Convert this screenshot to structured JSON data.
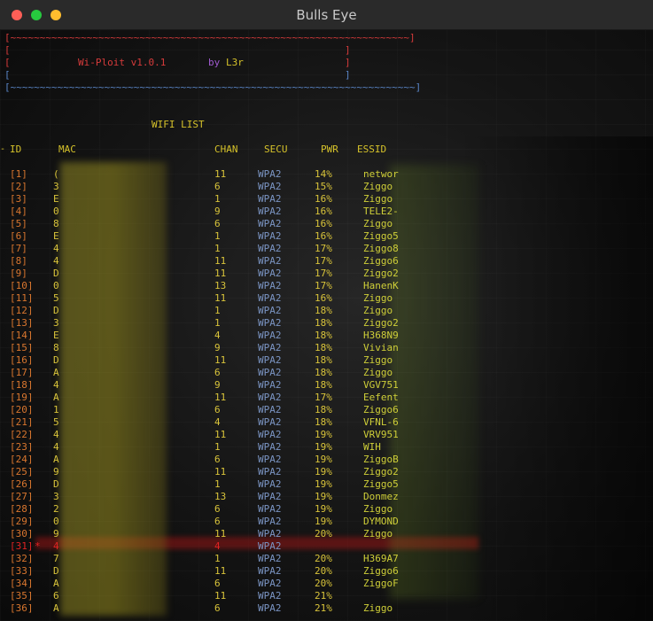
{
  "window": {
    "title": "Bulls Eye"
  },
  "banner": {
    "border_top": "[~~~~~~~~~~~~~~~~~~~~~~~~~~~~~~~~~~~~~~~~~~~~~~~~~~~~~~~~~~~~~~~~~~~~]",
    "side_left": "[",
    "side_right": "]",
    "border_bottom": "[~~~~~~~~~~~~~~~~~~~~~~~~~~~~~~~~~~~~~~~~~~~~~~~~~~~~~~~~~~~~~~~~~~~~~]",
    "app_name": "Wi-Ploit v1.0.1",
    "by_label": "by",
    "author": "L3r"
  },
  "list_title": "WIFI LIST",
  "columns": {
    "id": "ID",
    "mac": "MAC",
    "chan": "CHAN",
    "secu": "SECU",
    "pwr": "PWR",
    "essid": "ESSID"
  },
  "selected_row": 31,
  "rows": [
    {
      "idx": "[1]",
      "mac": "(",
      "chan": "11",
      "secu": "WPA2",
      "pwr": "14%",
      "essid": "networ"
    },
    {
      "idx": "[2]",
      "mac": "3",
      "chan": "6",
      "secu": "WPA2",
      "pwr": "15%",
      "essid": "Ziggo"
    },
    {
      "idx": "[3]",
      "mac": "E",
      "chan": "1",
      "secu": "WPA2",
      "pwr": "16%",
      "essid": "Ziggo"
    },
    {
      "idx": "[4]",
      "mac": "0",
      "chan": "9",
      "secu": "WPA2",
      "pwr": "16%",
      "essid": "TELE2-"
    },
    {
      "idx": "[5]",
      "mac": "8",
      "chan": "6",
      "secu": "WPA2",
      "pwr": "16%",
      "essid": "Ziggo"
    },
    {
      "idx": "[6]",
      "mac": "E",
      "chan": "1",
      "secu": "WPA2",
      "pwr": "16%",
      "essid": "Ziggo5"
    },
    {
      "idx": "[7]",
      "mac": "4",
      "chan": "1",
      "secu": "WPA2",
      "pwr": "17%",
      "essid": "Ziggo8"
    },
    {
      "idx": "[8]",
      "mac": "4",
      "chan": "11",
      "secu": "WPA2",
      "pwr": "17%",
      "essid": "Ziggo6"
    },
    {
      "idx": "[9]",
      "mac": "D",
      "chan": "11",
      "secu": "WPA2",
      "pwr": "17%",
      "essid": "Ziggo2"
    },
    {
      "idx": "[10]",
      "mac": "0",
      "chan": "13",
      "secu": "WPA2",
      "pwr": "17%",
      "essid": "HanenK"
    },
    {
      "idx": "[11]",
      "mac": "5",
      "chan": "11",
      "secu": "WPA2",
      "pwr": "16%",
      "essid": "Ziggo"
    },
    {
      "idx": "[12]",
      "mac": "D",
      "chan": "1",
      "secu": "WPA2",
      "pwr": "18%",
      "essid": "Ziggo"
    },
    {
      "idx": "[13]",
      "mac": "3",
      "chan": "1",
      "secu": "WPA2",
      "pwr": "18%",
      "essid": "Ziggo2"
    },
    {
      "idx": "[14]",
      "mac": "E",
      "chan": "4",
      "secu": "WPA2",
      "pwr": "18%",
      "essid": "H368N9"
    },
    {
      "idx": "[15]",
      "mac": "8",
      "chan": "9",
      "secu": "WPA2",
      "pwr": "18%",
      "essid": "Vivian"
    },
    {
      "idx": "[16]",
      "mac": "D",
      "chan": "11",
      "secu": "WPA2",
      "pwr": "18%",
      "essid": "Ziggo"
    },
    {
      "idx": "[17]",
      "mac": "A",
      "chan": "6",
      "secu": "WPA2",
      "pwr": "18%",
      "essid": "Ziggo"
    },
    {
      "idx": "[18]",
      "mac": "4",
      "chan": "9",
      "secu": "WPA2",
      "pwr": "18%",
      "essid": "VGV751"
    },
    {
      "idx": "[19]",
      "mac": "A",
      "chan": "11",
      "secu": "WPA2",
      "pwr": "17%",
      "essid": "Eefent"
    },
    {
      "idx": "[20]",
      "mac": "1",
      "chan": "6",
      "secu": "WPA2",
      "pwr": "18%",
      "essid": "Ziggo6"
    },
    {
      "idx": "[21]",
      "mac": "5",
      "chan": "4",
      "secu": "WPA2",
      "pwr": "18%",
      "essid": "VFNL-6"
    },
    {
      "idx": "[22]",
      "mac": "4",
      "chan": "11",
      "secu": "WPA2",
      "pwr": "19%",
      "essid": "VRV951"
    },
    {
      "idx": "[23]",
      "mac": "4",
      "chan": "1",
      "secu": "WPA2",
      "pwr": "19%",
      "essid": "WIH"
    },
    {
      "idx": "[24]",
      "mac": "A",
      "chan": "6",
      "secu": "WPA2",
      "pwr": "19%",
      "essid": "ZiggoB"
    },
    {
      "idx": "[25]",
      "mac": "9",
      "chan": "11",
      "secu": "WPA2",
      "pwr": "19%",
      "essid": "Ziggo2"
    },
    {
      "idx": "[26]",
      "mac": "D",
      "chan": "1",
      "secu": "WPA2",
      "pwr": "19%",
      "essid": "Ziggo5"
    },
    {
      "idx": "[27]",
      "mac": "3",
      "chan": "13",
      "secu": "WPA2",
      "pwr": "19%",
      "essid": "Donmez"
    },
    {
      "idx": "[28]",
      "mac": "2",
      "chan": "6",
      "secu": "WPA2",
      "pwr": "19%",
      "essid": "Ziggo"
    },
    {
      "idx": "[29]",
      "mac": "0",
      "chan": "6",
      "secu": "WPA2",
      "pwr": "19%",
      "essid": "DYMOND"
    },
    {
      "idx": "[30]",
      "mac": "9",
      "chan": "11",
      "secu": "WPA2",
      "pwr": "20%",
      "essid": "Ziggo"
    },
    {
      "idx": "[31]",
      "mark": "*",
      "mac": "4",
      "chan": "4",
      "secu": "WPA2",
      "pwr": "",
      "essid": ""
    },
    {
      "idx": "[32]",
      "mac": "7",
      "chan": "1",
      "secu": "WPA2",
      "pwr": "20%",
      "essid": "H369A7"
    },
    {
      "idx": "[33]",
      "mac": "D",
      "chan": "11",
      "secu": "WPA2",
      "pwr": "20%",
      "essid": "Ziggo6"
    },
    {
      "idx": "[34]",
      "mac": "A",
      "chan": "6",
      "secu": "WPA2",
      "pwr": "20%",
      "essid": "ZiggoF"
    },
    {
      "idx": "[35]",
      "mac": "6",
      "chan": "11",
      "secu": "WPA2",
      "pwr": "21%",
      "essid": ""
    },
    {
      "idx": "[36]",
      "mac": "A",
      "chan": "6",
      "secu": "WPA2",
      "pwr": "21%",
      "essid": "Ziggo"
    }
  ]
}
